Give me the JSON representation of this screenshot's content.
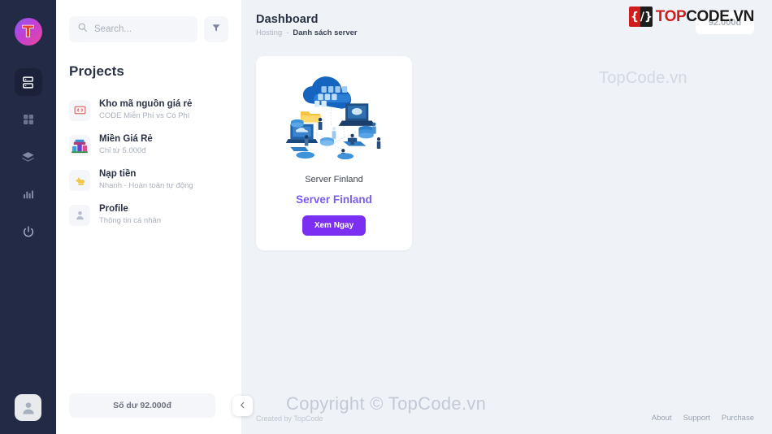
{
  "rail": {
    "logo_text": "T",
    "items": [
      {
        "name": "hosting-server",
        "icon": "server-icon",
        "active": true
      },
      {
        "name": "apps-grid",
        "icon": "grid-icon",
        "active": false
      },
      {
        "name": "layers",
        "icon": "layers-icon",
        "active": false
      },
      {
        "name": "statistics",
        "icon": "bar-chart-icon",
        "active": false
      },
      {
        "name": "logout",
        "icon": "power-icon",
        "active": false
      }
    ],
    "avatar_alt": "user-avatar"
  },
  "sidebar": {
    "search": {
      "placeholder": "Search...",
      "value": ""
    },
    "filter_label": "filter-icon",
    "section_title": "Projects",
    "projects": [
      {
        "name": "Kho mã nguồn giá rẻ",
        "sub": "CODE Miễn Phí vs Có Phí",
        "icon": "code-brackets-icon"
      },
      {
        "name": "Miền Giá Rẻ",
        "sub": "Chỉ từ 5.000đ",
        "icon": "domain-servers-icon"
      },
      {
        "name": "Nạp tiền",
        "sub": "Nhanh - Hoàn toàn tự động",
        "icon": "money-hand-icon"
      },
      {
        "name": "Profile",
        "sub": "Thông tin cá nhân",
        "icon": "person-icon"
      }
    ],
    "balance_label": "Số dư 92.000đ",
    "collapse_label": "collapse-sidebar"
  },
  "main": {
    "title": "Dashboard",
    "breadcrumb": {
      "root": "Hosting",
      "separator": "-",
      "current": "Danh sách server"
    },
    "balance_chip": "92.000đ",
    "card": {
      "server_name": "Server Finland",
      "title": "Server Finland",
      "button": "Xem Ngay"
    }
  },
  "brand": {
    "mark_left": "{",
    "mark_right": "/}",
    "word_top": "TOP",
    "word_code": "CODE",
    "word_vn": ".VN"
  },
  "watermarks": {
    "center": "TopCode.vn",
    "copyright": "Copyright © TopCode.vn"
  },
  "footer": {
    "created_by": "Created by TopCode",
    "links": [
      "About",
      "Support",
      "Purchase"
    ]
  },
  "colors": {
    "rail_bg": "#232a45",
    "rail_active": "#1b2138",
    "canvas_bg": "#eff2f7",
    "panel_bg": "#ffffff",
    "accent_purple": "#7b2ff2",
    "title_purple": "#7c5cf0",
    "text_dark": "#2b3245",
    "text_muted": "#a9b0bd",
    "brand_red": "#d21d1d",
    "brand_black": "#1c1c1c"
  }
}
